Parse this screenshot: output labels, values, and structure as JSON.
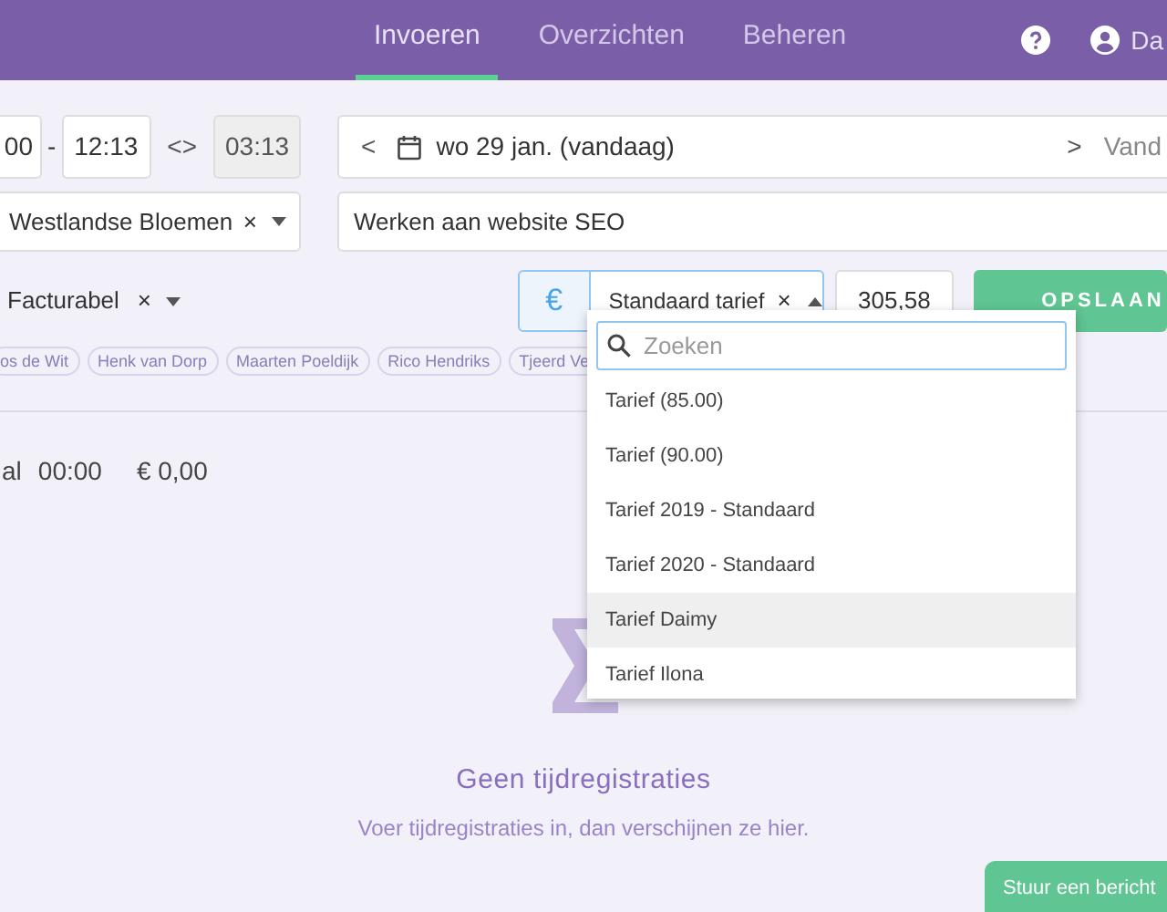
{
  "nav": {
    "items": [
      {
        "label": "Invoeren",
        "selected": true
      },
      {
        "label": "Overzichten",
        "selected": false
      },
      {
        "label": "Beheren",
        "selected": false
      }
    ],
    "user": "Da"
  },
  "time": {
    "start": "00",
    "separator": "-",
    "end": "12:13",
    "swap": "<>",
    "duration": "03:13"
  },
  "date": {
    "label": "wo 29 jan. (vandaag)",
    "prev": "<",
    "next": ">",
    "right": "Vand"
  },
  "client": {
    "value": "Westlandse Bloemen",
    "clear": "×"
  },
  "description": {
    "value": "Werken aan website SEO"
  },
  "billing": {
    "value": "Facturabel",
    "clear": "×"
  },
  "rate": {
    "currency": "€",
    "value": "Standaard tarief",
    "clear": "×",
    "open": true,
    "amount": "305,58"
  },
  "save_button": "OPSLAAN",
  "tags": [
    "os de Wit",
    "Henk van Dorp",
    "Maarten Poeldijk",
    "Rico Hendriks",
    "Tjeerd Ve"
  ],
  "totals": {
    "label": "al",
    "time": "00:00",
    "amount": "€ 0,00"
  },
  "dropdown": {
    "placeholder": "Zoeken",
    "options": [
      {
        "label": "Tarief (85.00)",
        "highlighted": false
      },
      {
        "label": "Tarief (90.00)",
        "highlighted": false
      },
      {
        "label": "Tarief 2019 - Standaard",
        "highlighted": false
      },
      {
        "label": "Tarief 2020 - Standaard",
        "highlighted": false
      },
      {
        "label": "Tarief Daimy",
        "highlighted": true
      },
      {
        "label": "Tarief Ilona",
        "highlighted": false
      }
    ]
  },
  "empty": {
    "title": "Geen tijdregistraties",
    "message": "Voer tijdregistraties in, dan verschijnen ze hier."
  },
  "chat_button": "Stuur een bericht"
}
